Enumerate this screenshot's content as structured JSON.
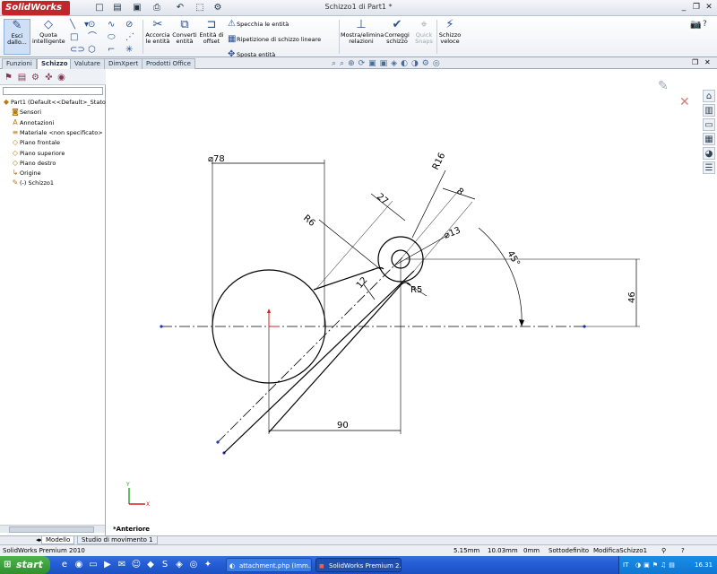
{
  "app": {
    "logo": "SolidWorks",
    "document_title": "Schizzo1 di Part1 *"
  },
  "ribbon": {
    "exit_sketch": "Esci dallo...",
    "smart_dim": "Quota intelligente",
    "trim": "Accorcia le entità",
    "convert": "Converti entità",
    "offset": "Entità di offset",
    "mirror": "Specchia le entità",
    "pattern": "Ripetizione di schizzo lineare",
    "move": "Sposta entità",
    "relations": "Mostra/elimina relazioni",
    "repair": "Correggi schizzo",
    "quick_snaps": "Quick Snaps",
    "rapid_sketch": "Schizzo veloce"
  },
  "tabs": [
    "Funzioni",
    "Schizzo",
    "Valutare",
    "DimXpert",
    "Prodotti Office"
  ],
  "tree": [
    {
      "label": "Part1  (Default<<Default>_Stato",
      "icon": "part-icon",
      "level": 0
    },
    {
      "label": "Sensori",
      "icon": "sensor-icon",
      "level": 1
    },
    {
      "label": "Annotazioni",
      "icon": "annotation-icon",
      "level": 1
    },
    {
      "label": "Materiale <non specificato>",
      "icon": "material-icon",
      "level": 1
    },
    {
      "label": "Piano frontale",
      "icon": "plane-icon",
      "level": 1
    },
    {
      "label": "Piano superiore",
      "icon": "plane-icon",
      "level": 1
    },
    {
      "label": "Piano destro",
      "icon": "plane-icon",
      "level": 1
    },
    {
      "label": "Origine",
      "icon": "origin-icon",
      "level": 1
    },
    {
      "label": "(-) Schizzo1",
      "icon": "sketch-icon",
      "level": 1
    }
  ],
  "dimensions": {
    "d78": "78",
    "r16": "R16",
    "d27": "27",
    "d8": "8",
    "r6": "R6",
    "d13": "13",
    "a45": "45°",
    "d12": "12",
    "r5": "R5",
    "d46": "46",
    "d90": "90"
  },
  "view_label": "*Anteriore",
  "model_tabs": [
    "Modello",
    "Studio di movimento 1"
  ],
  "status": {
    "product": "SolidWorks Premium 2010",
    "x": "5.15mm",
    "y": "10.03mm",
    "z": "0mm",
    "state": "Sottodefinito",
    "mode": "ModificaSchizzo1"
  },
  "taskbar": {
    "start": "start",
    "tasks": [
      "attachment.php (Imm...",
      "SolidWorks Premium 2..."
    ],
    "lang": "IT",
    "clock": "16.31"
  }
}
